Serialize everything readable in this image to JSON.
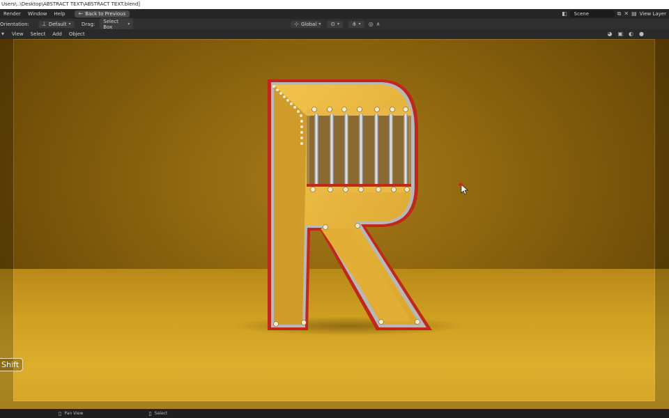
{
  "window": {
    "title": "Users\\..\\Desktop\\ABSTRACT TEXT\\ABSTRACT TEXT.blend]"
  },
  "menu": {
    "items": [
      "Render",
      "Window",
      "Help"
    ],
    "back_label": "Back to Previous"
  },
  "topright": {
    "scene": "Scene",
    "view_layer": "View Layer"
  },
  "toolbar": {
    "orientation_label": "Orientation:",
    "orientation_value": "Default",
    "drag_label": "Drag:",
    "drag_value": "Select Box",
    "transform_value": "Global"
  },
  "viewport_header": {
    "items": [
      "View",
      "Select",
      "Add",
      "Object"
    ]
  },
  "overlay": {
    "shift_key": "Shift"
  },
  "statusbar": {
    "pan": "Pan View",
    "select": "Select"
  },
  "colors": {
    "background_gold": "#8e650f",
    "letter_yellow": "#e6b93a",
    "trim_red": "#c0281c"
  }
}
